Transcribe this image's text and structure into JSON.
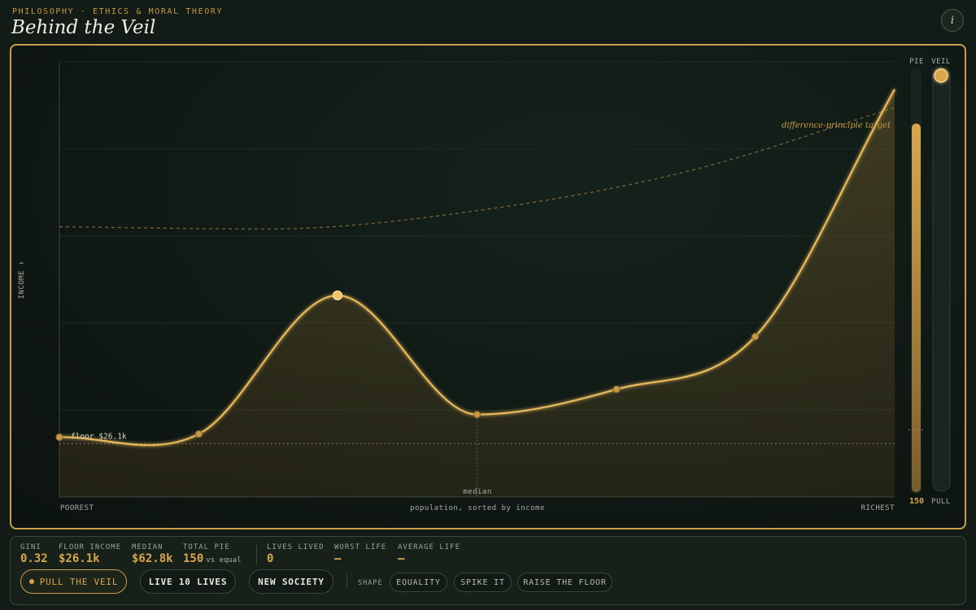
{
  "header": {
    "eyebrow": "PHILOSOPHY · ETHICS & MORAL THEORY",
    "title": "Behind the Veil",
    "info_icon": "info-icon",
    "info_glyph": "i"
  },
  "chart_data": {
    "type": "area",
    "ylabel": "INCOME ↑",
    "xlabel": "population, sorted by income",
    "x_start_label": "POOREST",
    "x_end_label": "RICHEST",
    "median_label": "median",
    "floor_label": "floor $26.1k",
    "target_label": "difference-principle target",
    "income_curve": [
      {
        "x": 0.0,
        "y": 26.1
      },
      {
        "x": 0.167,
        "y": 27.5
      },
      {
        "x": 0.333,
        "y": 88
      },
      {
        "x": 0.5,
        "y": 36
      },
      {
        "x": 0.667,
        "y": 47
      },
      {
        "x": 0.833,
        "y": 70
      },
      {
        "x": 1.0,
        "y": 178
      }
    ],
    "target_curve": [
      {
        "x": 0.0,
        "y": 118
      },
      {
        "x": 0.25,
        "y": 117
      },
      {
        "x": 0.5,
        "y": 125
      },
      {
        "x": 0.75,
        "y": 142
      },
      {
        "x": 1.0,
        "y": 170
      }
    ],
    "floor_value": 26.1,
    "median_x": 0.5,
    "peak_point_index": 2,
    "ylim": [
      0,
      190
    ],
    "grid": true
  },
  "pie_meter": {
    "label": "PIE",
    "value": "150",
    "fill_fraction": 0.87,
    "equal_marker_fraction": 0.15
  },
  "veil_slider": {
    "label": "VEIL",
    "bottom_label": "PULL",
    "position_fraction": 1.0
  },
  "stats": {
    "gini": {
      "label": "GINI",
      "value": "0.32"
    },
    "floor_income": {
      "label": "FLOOR INCOME",
      "value": "$26.1k"
    },
    "median": {
      "label": "MEDIAN",
      "value": "$62.8k"
    },
    "total_pie": {
      "label": "TOTAL PIE",
      "value": "150",
      "suffix": "vs equal"
    },
    "lives_lived": {
      "label": "LIVES LIVED",
      "value": "0"
    },
    "worst_life": {
      "label": "WORST LIFE",
      "value": "—"
    },
    "average_life": {
      "label": "AVERAGE LIFE",
      "value": "—"
    }
  },
  "controls": {
    "pull_veil": "PULL THE VEIL",
    "live_lives": "LIVE 10 LIVES",
    "new_society": "NEW SOCIETY",
    "shape_label": "SHAPE",
    "shapes": [
      "EQUALITY",
      "SPIKE IT",
      "RAISE THE FLOOR"
    ]
  },
  "colors": {
    "accent": "#d9a64e",
    "curve": "#e8b95a",
    "background": "#121b16"
  }
}
